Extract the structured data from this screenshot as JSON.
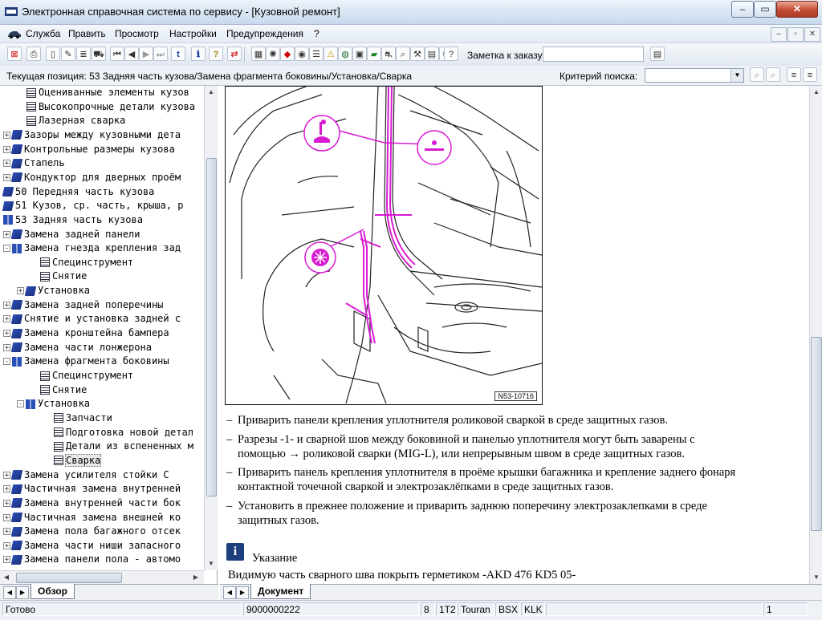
{
  "window": {
    "title": "Электронная справочная система по сервису - [Кузовной ремонт]",
    "controls": [
      "–",
      "▭",
      "✕"
    ]
  },
  "menu": {
    "items": [
      "Служба",
      "Править",
      "Просмотр",
      "Настройки",
      "Предупреждения",
      "?"
    ],
    "mdi_controls": [
      "–",
      "▫",
      "✕"
    ]
  },
  "toolbar": {
    "zakaz_label": "Заметка к заказу:"
  },
  "position": {
    "text": "Текущая позиция: 53 Задняя часть кузова/Замена фрагмента боковины/Установка/Сварка",
    "search_label": "Критерий поиска:",
    "search_value": ""
  },
  "tree": {
    "items": [
      {
        "text": "Оцениванные элементы кузов",
        "icon": "page",
        "exp": "",
        "indent": 1
      },
      {
        "text": "Высокопрочные детали кузова",
        "icon": "page",
        "exp": "",
        "indent": 1
      },
      {
        "text": "Лазерная сварка",
        "icon": "page",
        "exp": "",
        "indent": 1
      },
      {
        "text": "Зазоры между кузовными дета",
        "icon": "book",
        "exp": "+",
        "indent": 0
      },
      {
        "text": "Контрольные размеры кузова",
        "icon": "book",
        "exp": "+",
        "indent": 0
      },
      {
        "text": "Стапель",
        "icon": "book",
        "exp": "+",
        "indent": 0
      },
      {
        "text": "Кондуктор для дверных проём",
        "icon": "book",
        "exp": "+",
        "indent": 0
      },
      {
        "text": "50 Передняя часть кузова",
        "icon": "book",
        "exp": "",
        "indent": -1
      },
      {
        "text": "51 Кузов, ср. часть, крыша, р",
        "icon": "book",
        "exp": "",
        "indent": -1
      },
      {
        "text": "53 Задняя часть кузова",
        "icon": "openbook",
        "exp": "",
        "indent": -1
      },
      {
        "text": "Замена задней панели",
        "icon": "book",
        "exp": "+",
        "indent": 0
      },
      {
        "text": "Замена гнезда крепления зад",
        "icon": "openbook",
        "exp": "-",
        "indent": 0
      },
      {
        "text": "Специнструмент",
        "icon": "page",
        "exp": "",
        "indent": 2
      },
      {
        "text": "Снятие",
        "icon": "page",
        "exp": "",
        "indent": 2
      },
      {
        "text": "Установка",
        "icon": "book",
        "exp": "+",
        "indent": 1
      },
      {
        "text": "Замена задней поперечины",
        "icon": "book",
        "exp": "+",
        "indent": 0
      },
      {
        "text": "Снятие и установка задней с",
        "icon": "book",
        "exp": "+",
        "indent": 0
      },
      {
        "text": "Замена кронштейна бампера",
        "icon": "book",
        "exp": "+",
        "indent": 0
      },
      {
        "text": "Замена части лонжерона",
        "icon": "book",
        "exp": "+",
        "indent": 0
      },
      {
        "text": "Замена фрагмента боковины",
        "icon": "openbook",
        "exp": "-",
        "indent": 0
      },
      {
        "text": "Специнструмент",
        "icon": "page",
        "exp": "",
        "indent": 2
      },
      {
        "text": "Снятие",
        "icon": "page",
        "exp": "",
        "indent": 2
      },
      {
        "text": "Установка",
        "icon": "openbook",
        "exp": "-",
        "indent": 1
      },
      {
        "text": "Запчасти",
        "icon": "page",
        "exp": "",
        "indent": 3
      },
      {
        "text": "Подготовка новой детал",
        "icon": "page",
        "exp": "",
        "indent": 3
      },
      {
        "text": "Детали из вспененных м",
        "icon": "page",
        "exp": "",
        "indent": 3
      },
      {
        "text": "Сварка",
        "icon": "page",
        "exp": "",
        "indent": 3,
        "selected": true
      },
      {
        "text": "Замена усилителя стойки С",
        "icon": "book",
        "exp": "+",
        "indent": 0
      },
      {
        "text": "Частичная замена внутренней",
        "icon": "book",
        "exp": "+",
        "indent": 0
      },
      {
        "text": "Замена внутренней части бок",
        "icon": "book",
        "exp": "+",
        "indent": 0
      },
      {
        "text": "Частичная замена внешней ко",
        "icon": "book",
        "exp": "+",
        "indent": 0
      },
      {
        "text": "Замена пола багажного отсек",
        "icon": "book",
        "exp": "+",
        "indent": 0
      },
      {
        "text": "Замена части ниши запасного",
        "icon": "book",
        "exp": "+",
        "indent": 0
      },
      {
        "text": "Замена панели пола - автомо",
        "icon": "book",
        "exp": "+",
        "indent": 0
      }
    ]
  },
  "document": {
    "figure_code": "N53-10716",
    "steps": [
      {
        "lines": [
          "Приварить панели крепления уплотнителя роликовой сваркой в среде защитных газов."
        ]
      },
      {
        "lines": [
          "Разрезы -1- и сварной шов между боковиной и панелью уплотнителя могут быть заварены с",
          "помощью → роликовой сварки (MIG-L), или непрерывным швом в среде защитных газов."
        ]
      },
      {
        "lines": [
          "Приварить панель крепления уплотнителя в проёме крышки багажника и крепление заднего фонаря",
          "контактной точечной сваркой и электрозаклёпками в среде защитных газов."
        ]
      },
      {
        "lines": [
          "Установить в прежнее положение и приварить заднюю поперечину электрозаклепками в среде",
          "защитных газов."
        ]
      }
    ],
    "note_title": "Указание",
    "note_text": "Видимую часть сварного шва покрыть герметиком -AKD 476 KD5 05-"
  },
  "tabs": {
    "left": "Обзор",
    "right": "Документ"
  },
  "status": {
    "ready": "Готово",
    "code": "9000000222",
    "f1": "8",
    "f2": "1T2",
    "model": "Touran",
    "engine": "BSX",
    "gear": "KLK",
    "page": "1"
  },
  "colors": {
    "accent_magenta": "#d81bd2",
    "tree_book": "#2b4fb8"
  }
}
